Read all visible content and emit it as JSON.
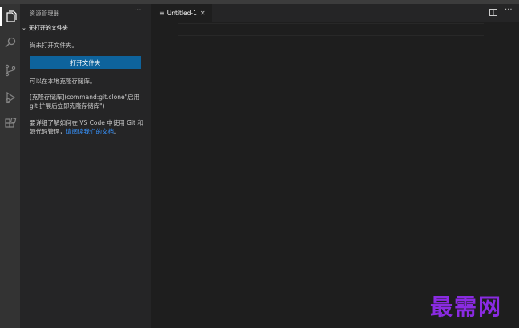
{
  "sidebar": {
    "title": "资源管理器",
    "more": "···",
    "section_title": "无打开的文件夹",
    "no_folder_text": "尚未打开文件夹。",
    "open_folder_button": "打开文件夹",
    "clone_text": "可以在本地克隆存储库。",
    "clone_command_text": "[克隆存储库](command:git.clone\"启用 git 扩展后立即克隆存储库\")",
    "learn_text": "要详细了解如何在 VS Code 中使用 Git 和源代码管理，",
    "learn_link": "请阅读我们的文档",
    "learn_end": "。"
  },
  "activity_icons": [
    "explorer-icon",
    "search-icon",
    "source-control-icon",
    "run-debug-icon",
    "extensions-icon"
  ],
  "editor": {
    "tab_label": "Untitled-1",
    "tab_close": "✕",
    "more": "···"
  },
  "watermark": "最需网",
  "colors": {
    "accent_button": "#0e639c",
    "link": "#3794ff",
    "watermark": "#8a2be2"
  }
}
